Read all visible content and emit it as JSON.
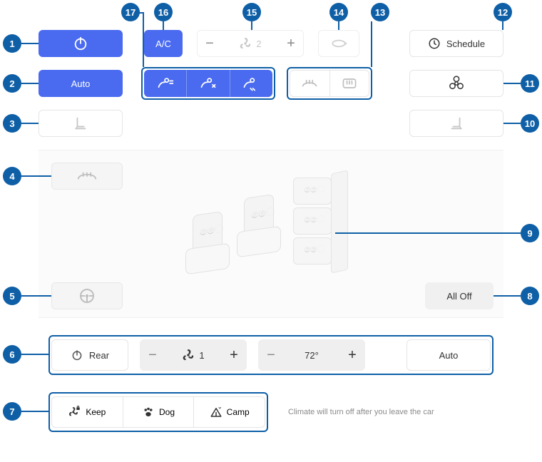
{
  "top": {
    "ac_label": "A/C",
    "fan_level": "2",
    "schedule_label": "Schedule",
    "auto_label": "Auto"
  },
  "seats": {
    "all_off": "All Off"
  },
  "rear": {
    "label": "Rear",
    "fan_level": "1",
    "temp": "72°",
    "auto": "Auto"
  },
  "modes": {
    "keep": "Keep",
    "dog": "Dog",
    "camp": "Camp"
  },
  "note": "Climate will turn off after you leave the car",
  "callouts": {
    "c1": "1",
    "c2": "2",
    "c3": "3",
    "c4": "4",
    "c5": "5",
    "c6": "6",
    "c7": "7",
    "c8": "8",
    "c9": "9",
    "c10": "10",
    "c11": "11",
    "c12": "12",
    "c13": "13",
    "c14": "14",
    "c15": "15",
    "c16": "16",
    "c17": "17"
  }
}
